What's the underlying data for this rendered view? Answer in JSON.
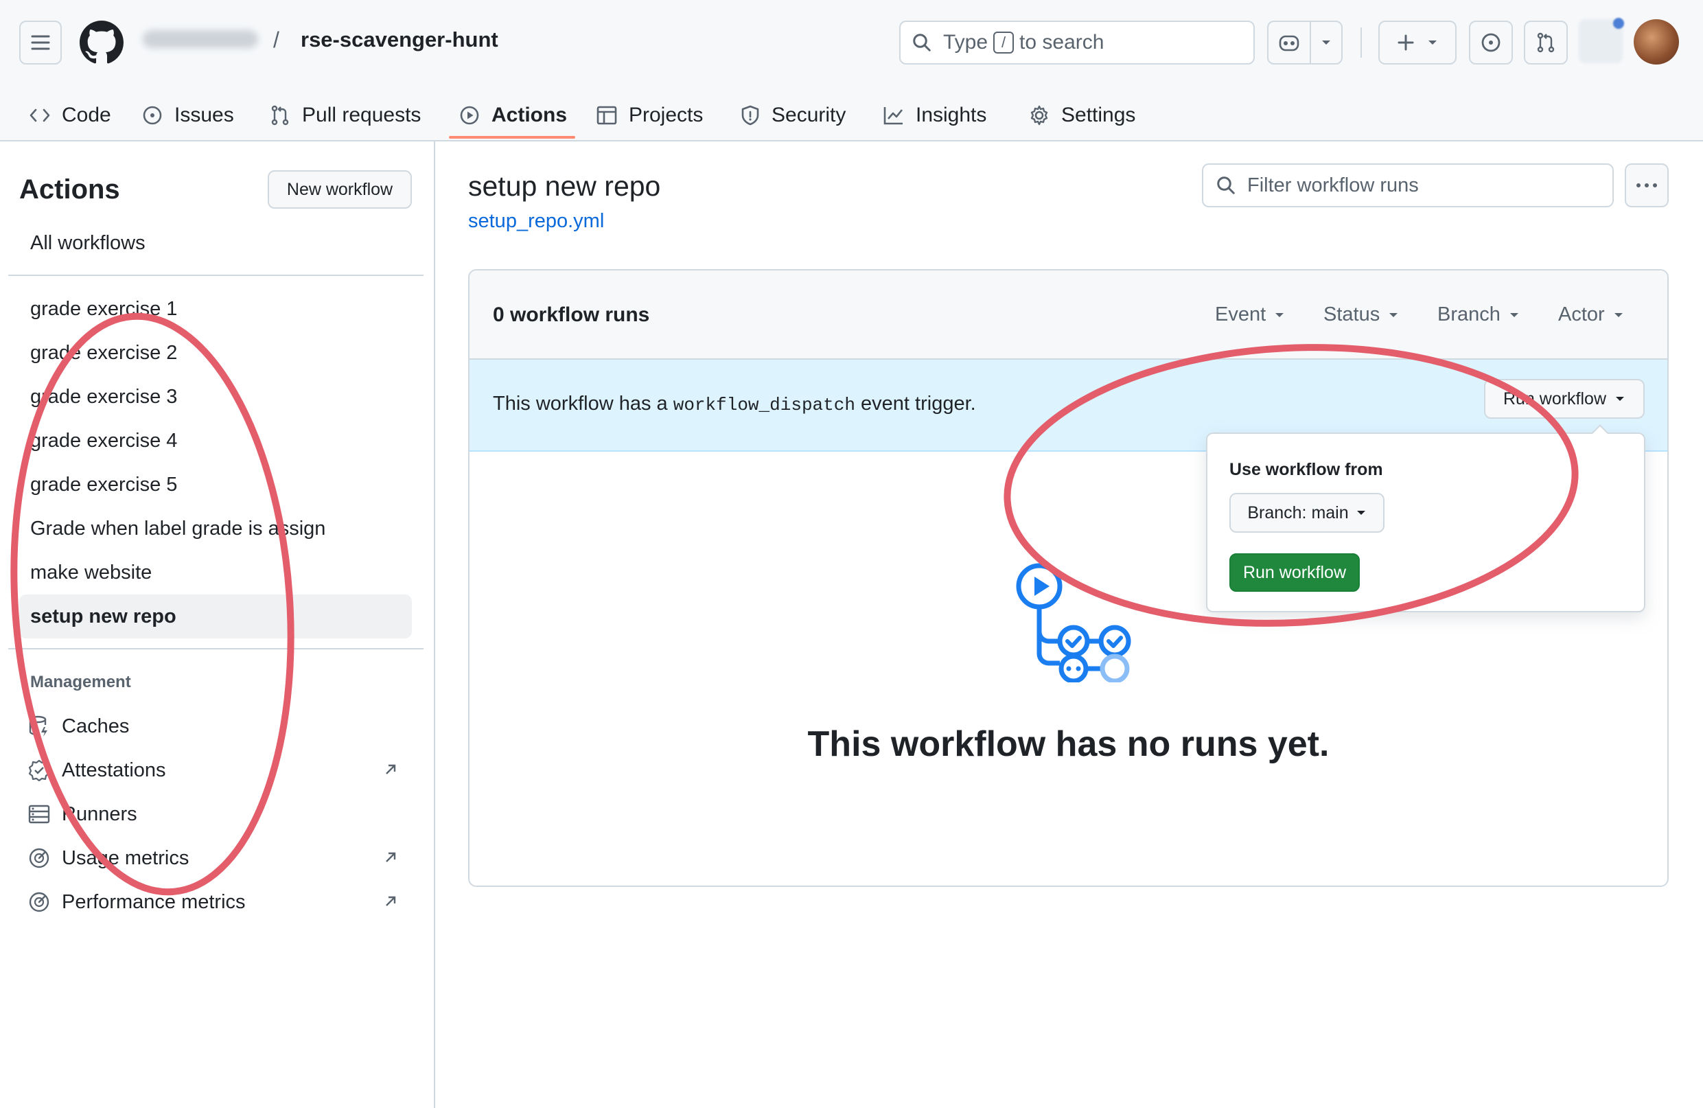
{
  "header": {
    "repo_name": "rse-scavenger-hunt",
    "separator": "/",
    "search_prefix": "Type",
    "search_key": "/",
    "search_suffix": "to search"
  },
  "tabs": [
    {
      "label": "Code",
      "icon": "code-icon"
    },
    {
      "label": "Issues",
      "icon": "issue-icon"
    },
    {
      "label": "Pull requests",
      "icon": "pull-request-icon"
    },
    {
      "label": "Actions",
      "icon": "play-icon",
      "active": true
    },
    {
      "label": "Projects",
      "icon": "table-icon"
    },
    {
      "label": "Security",
      "icon": "shield-icon"
    },
    {
      "label": "Insights",
      "icon": "graph-icon"
    },
    {
      "label": "Settings",
      "icon": "gear-icon"
    }
  ],
  "sidebar": {
    "title": "Actions",
    "new_workflow": "New workflow",
    "all_workflows": "All workflows",
    "workflows": [
      "grade exercise 1",
      "grade exercise 2",
      "grade exercise 3",
      "grade exercise 4",
      "grade exercise 5",
      "Grade when label grade is assign",
      "make website",
      "setup new repo"
    ],
    "selected_workflow": "setup new repo",
    "management_heading": "Management",
    "management": [
      {
        "label": "Caches",
        "icon": "database-icon"
      },
      {
        "label": "Attestations",
        "icon": "verified-icon",
        "external": true
      },
      {
        "label": "Runners",
        "icon": "server-icon"
      },
      {
        "label": "Usage metrics",
        "icon": "meter-icon",
        "external": true
      },
      {
        "label": "Performance metrics",
        "icon": "meter-icon",
        "external": true
      }
    ]
  },
  "main": {
    "workflow_title": "setup new repo",
    "workflow_file": "setup_repo.yml",
    "filter_placeholder": "Filter workflow runs",
    "runs_count": "0 workflow runs",
    "filters": [
      "Event",
      "Status",
      "Branch",
      "Actor"
    ],
    "dispatch_prefix": "This workflow has a",
    "dispatch_code": "workflow_dispatch",
    "dispatch_suffix": "event trigger.",
    "run_workflow_button": "Run workflow",
    "empty_title": "This workflow has no runs yet."
  },
  "popover": {
    "title": "Use workflow from",
    "branch_button": "Branch: main",
    "run_button": "Run workflow"
  },
  "colors": {
    "accent_link": "#0969da",
    "tab_underline": "#fd8c73",
    "primary_green": "#1f883d",
    "dispatch_banner": "#ddf4ff",
    "annotation_ring": "#e35d6a",
    "workflow_icon_blue": "#1a7df0"
  }
}
